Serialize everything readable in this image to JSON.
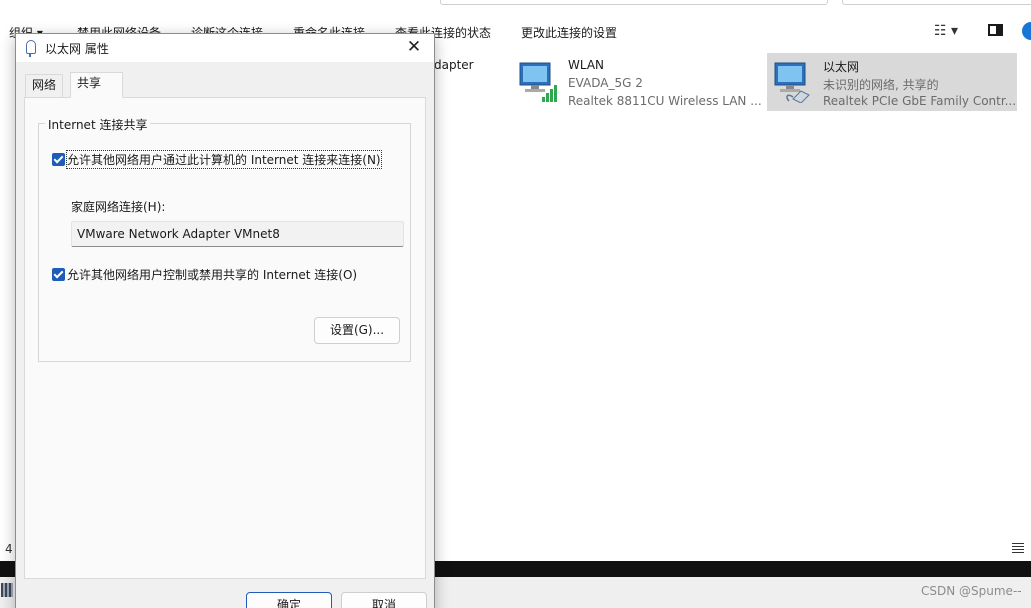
{
  "explorer": {
    "toolbar": {
      "items": [
        "组织 ▾",
        "禁用此网络设备",
        "诊断这个连接",
        "重命名此连接",
        "查看此连接的状态",
        "更改此连接的设置"
      ]
    },
    "partial_label": "dapter",
    "connections": [
      {
        "name": "WLAN",
        "status": "EVADA_5G 2",
        "adapter": "Realtek 8811CU Wireless LAN ...",
        "icon": "wifi-network-icon",
        "selected": false
      },
      {
        "name": "以太网",
        "status": "未识别的网络, 共享的",
        "adapter": "Realtek PCIe GbE Family Contr...",
        "icon": "ethernet-network-icon",
        "selected": true
      }
    ],
    "status_count": "4",
    "watermark": "CSDN @Spume--"
  },
  "dialog": {
    "title": "以太网 属性",
    "tabs": [
      {
        "label": "网络",
        "active": false
      },
      {
        "label": "共享",
        "active": true
      }
    ],
    "group_label": "Internet 连接共享",
    "checkbox1_label": "允许其他网络用户通过此计算机的 Internet 连接来连接(N)",
    "checkbox1_checked": true,
    "home_network_label": "家庭网络连接(H):",
    "home_network_value": "VMware Network Adapter VMnet8",
    "checkbox2_label": "允许其他网络用户控制或禁用共享的 Internet 连接(O)",
    "checkbox2_checked": true,
    "settings_button": "设置(G)...",
    "ok_button": "确定",
    "cancel_button": "取消"
  },
  "colors": {
    "accent": "#1f5bb8",
    "dialog_bg": "#f0f0f0",
    "selected_tile": "#d9d9d9"
  }
}
